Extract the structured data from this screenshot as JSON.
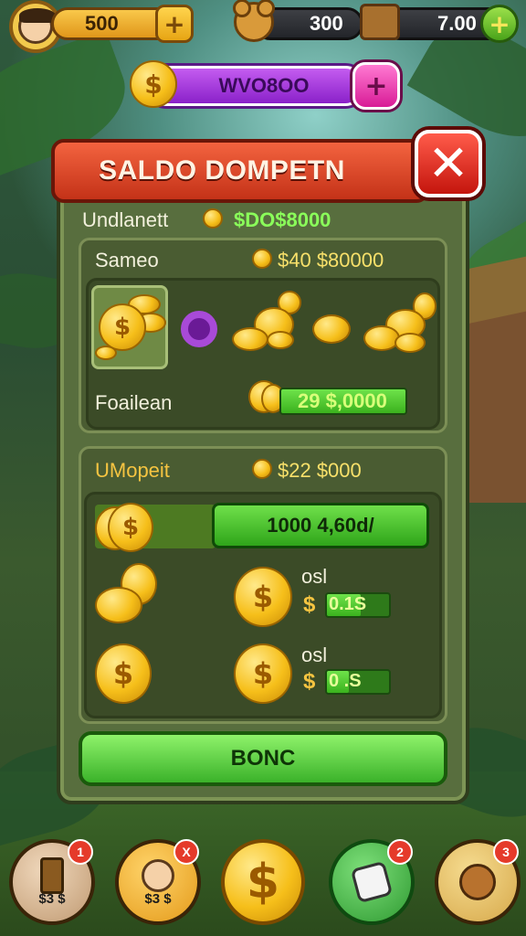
{
  "hud": {
    "currency_1": "500",
    "currency_2": "300",
    "currency_3": "7.00",
    "plus_symbol": "+"
  },
  "sub_bar": {
    "label": "WVO8OO",
    "coin_symbol": "$",
    "plus_symbol": "+"
  },
  "dialog": {
    "title": "SALDO DOMPETN",
    "close_symbol": "✕",
    "header_row": {
      "label": "Undlanett",
      "value": "$DO$8000"
    },
    "section_1": {
      "label": "Sameo",
      "value": "$40 $80000",
      "footer_label": "Foailean",
      "footer_value": "29 $,0000"
    },
    "section_2": {
      "label": "UMopeit",
      "value": "$22 $000",
      "green_bar_value": "1000 4,60d/",
      "rows": [
        {
          "label": "osl",
          "value": "0.1S",
          "progress": 0.55
        },
        {
          "label": "osl",
          "value": "0 .S",
          "progress": 0.35
        }
      ]
    },
    "bonus_button": "BONC"
  },
  "bottom_nav": [
    {
      "label": "$3 $",
      "badge": "1",
      "icon": "totem-icon",
      "color": "#d8b490"
    },
    {
      "label": "$3 $",
      "badge": "X",
      "icon": "character-icon",
      "color": "#f3b43a"
    },
    {
      "label": "$",
      "badge": "",
      "icon": "dollar-coin-icon",
      "color": "#f6bf1a"
    },
    {
      "label": "",
      "badge": "2",
      "icon": "dice-icon",
      "color": "#46b24a"
    },
    {
      "label": "",
      "badge": "3",
      "icon": "pet-icon",
      "color": "#e9c06a"
    }
  ],
  "colors": {
    "panel": "#586e3e",
    "title_banner": "#e0492b",
    "green_value": "#8aff5a",
    "gold_label": "#f5c441"
  }
}
